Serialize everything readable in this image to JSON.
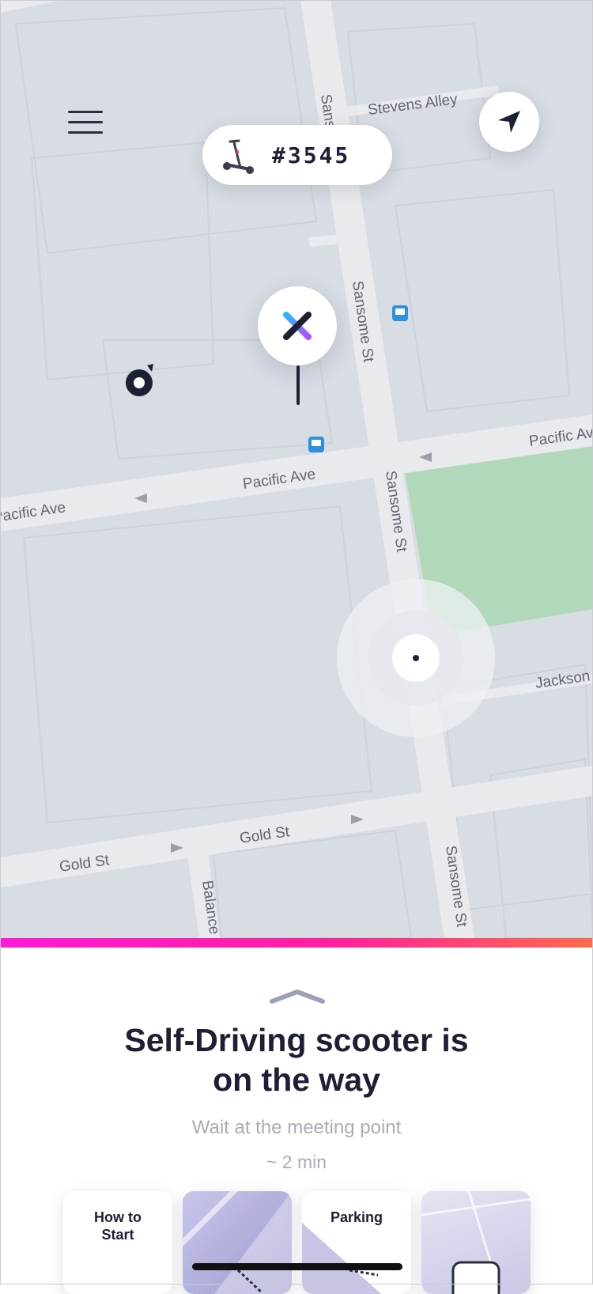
{
  "map": {
    "streets": [
      "Stevens Alley",
      "Sansome St",
      "Sansome St",
      "Sansome St",
      "Sansome St",
      "Pacific Ave",
      "Pacific Ave",
      "Pacific Ave",
      "Jackson",
      "Gold St",
      "Gold St",
      "Balance"
    ],
    "colors": {
      "land": "#d8dce3",
      "road": "#e9eaed",
      "park": "#b1d9b9",
      "bus": "#2f8fe0"
    }
  },
  "header": {
    "menu_icon": "hamburger-icon",
    "scooter_id": "#3545",
    "scooter_icon": "scooter-icon",
    "locate_icon": "navigation-arrow-icon"
  },
  "markers": {
    "destination_icon": "x-logo-icon",
    "scooter_marker_icon": "scooter-marker-icon",
    "user_location_icon": "user-location-icon",
    "bus_stop_icon": "bus-stop-icon"
  },
  "sheet": {
    "title_line1": "Self-Driving scooter is",
    "title_line2": "on the way",
    "subtitle": "Wait at the meeting point",
    "eta": "~ 2 min",
    "handle_icon": "chevron-up-icon",
    "cards": [
      {
        "label_line1": "How to",
        "label_line2": "Start"
      },
      {
        "label_line1": "",
        "label_line2": ""
      },
      {
        "label_line1": "Parking",
        "label_line2": ""
      },
      {
        "label_line1": "",
        "label_line2": ""
      }
    ]
  },
  "colors": {
    "accent_start": "#ff1ad6",
    "accent_end": "#ff6a4d",
    "text_dark": "#1d2035",
    "text_muted": "#a9acb8"
  }
}
